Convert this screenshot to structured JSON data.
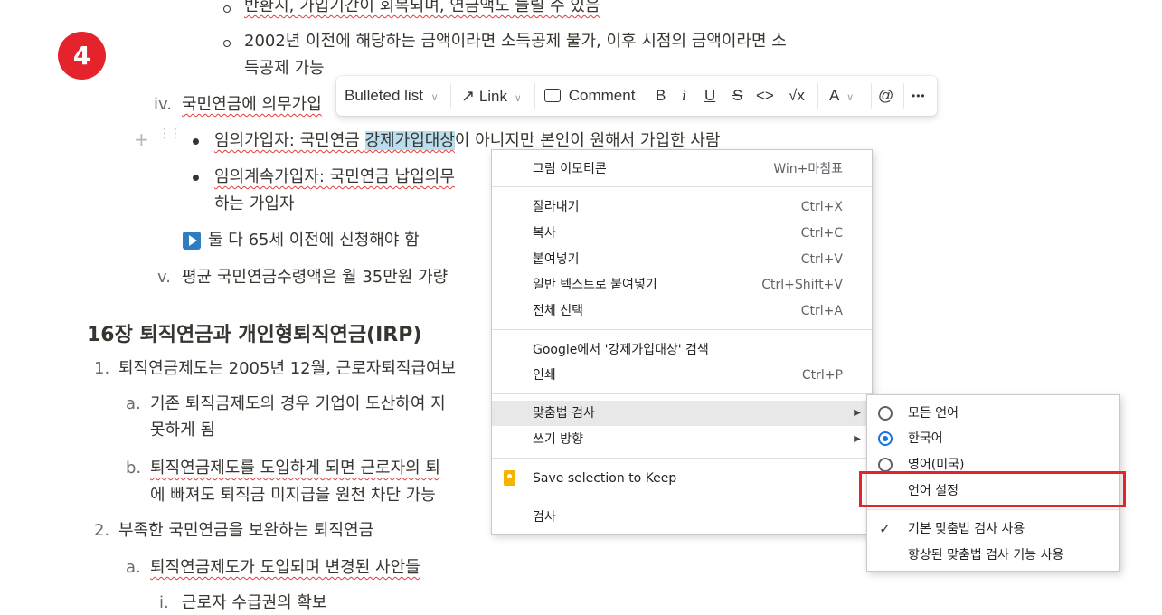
{
  "step_badge": "4",
  "doc": {
    "line_top_partial": "반환시, 가입기간이 회복되며, 연금액도 늘릴 수 있음",
    "line_2002_a": "2002년 이전에 해당하는 금액이라면 소득공제 불가, 이후 시점의 금액이라면 소",
    "line_2002_b": "득공제 가능",
    "iv_marker": "iv.",
    "iv_text": "국민연금에 의무가입",
    "bullet1_a": "임의가입자: 국민연금 ",
    "bullet1_sel": "강제가입대상",
    "bullet1_b": "이 아니지만 본인이 원해서 가입한 사람",
    "bullet2_a": "임의계속가입자: 국민연금 납입의무",
    "bullet2_b": "하는 가입자",
    "arrow_line": "둘 다 65세 이전에 신청해야 함",
    "v_marker": "v.",
    "v_text": "평균 국민연금수령액은 월 35만원 가량",
    "heading": "16장 퇴직연금과 개인형퇴직연금(IRP)",
    "item1_marker": "1.",
    "item1_text": "퇴직연금제도는 2005년 12월, 근로자퇴직급여보",
    "a_marker": "a.",
    "a_text_1": "기존 퇴직금제도의 경우 기업이 도산하여 지",
    "a_text_2": "못하게 됨",
    "b_marker": "b.",
    "b_text_1": "퇴직연금제도를 도입하게 되면 근로자의 퇴",
    "b_text_2": "에 빠져도 퇴직금 미지급을 원천 차단 가능",
    "item2_marker": "2.",
    "item2_text": "부족한 국민연금을 보완하는 퇴직연금",
    "a2_marker": "a.",
    "a2_text": "퇴직연금제도가 도입되며 변경된 사안들",
    "i_marker": "i.",
    "i_text": "근로자 수급권의 확보"
  },
  "toolbar": {
    "block_type": "Bulleted list",
    "link": "Link",
    "comment": "Comment",
    "bold": "B",
    "italic": "i",
    "underline": "U",
    "strike": "S",
    "code": "<>",
    "equation": "√x",
    "color": "A",
    "mention": "@",
    "more": "•••"
  },
  "context_menu": {
    "emoji": "그림 이모티콘",
    "emoji_sc": "Win+마침표",
    "cut": "잘라내기",
    "cut_sc": "Ctrl+X",
    "copy": "복사",
    "copy_sc": "Ctrl+C",
    "paste": "붙여넣기",
    "paste_sc": "Ctrl+V",
    "paste_plain": "일반 텍스트로 붙여넣기",
    "paste_plain_sc": "Ctrl+Shift+V",
    "select_all": "전체 선택",
    "select_all_sc": "Ctrl+A",
    "google_search": "Google에서 '강제가입대상' 검색",
    "print": "인쇄",
    "print_sc": "Ctrl+P",
    "spellcheck": "맞춤법 검사",
    "writing_direction": "쓰기 방향",
    "save_keep": "Save selection to Keep",
    "inspect": "검사"
  },
  "spell_submenu": {
    "all_languages": "모든 언어",
    "korean": "한국어",
    "english_us": "영어(미국)",
    "language_settings": "언어 설정",
    "basic_spellcheck": "기본 맞춤법 검사 사용",
    "enhanced_spellcheck": "향상된 맞춤법 검사 기능 사용"
  },
  "colors": {
    "badge": "#e5232d",
    "highlight_box": "#e5232d",
    "radio_selected": "#1a73e8",
    "selection": "#b9dcef",
    "arrow_icon_bg": "#2e7cc4"
  }
}
